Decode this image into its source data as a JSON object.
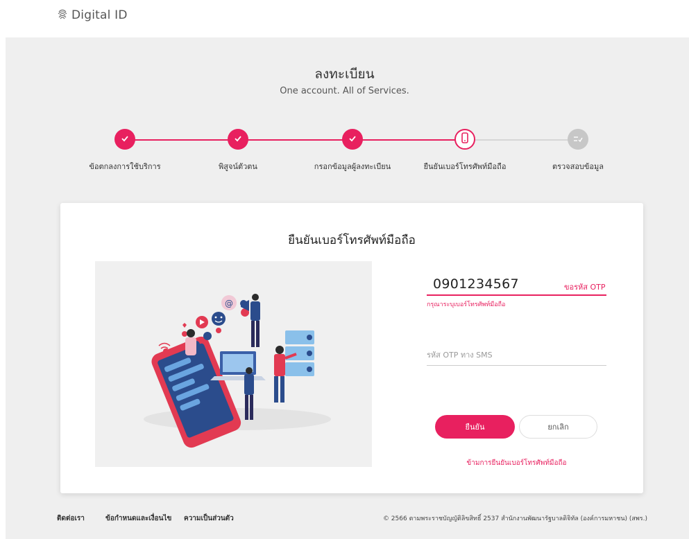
{
  "header": {
    "brand": "Digital ID"
  },
  "page": {
    "title": "ลงทะเบียน",
    "subtitle": "One account. All of Services."
  },
  "stepper": {
    "steps": [
      {
        "label": "ข้อตกลงการใช้บริการ",
        "state": "done"
      },
      {
        "label": "พิสูจน์ตัวตน",
        "state": "done"
      },
      {
        "label": "กรอกข้อมูลผู้ลงทะเบียน",
        "state": "done"
      },
      {
        "label": "ยืนยันเบอร์โทรศัพท์มือถือ",
        "state": "current"
      },
      {
        "label": "ตรวจสอบข้อมูล",
        "state": "todo"
      }
    ]
  },
  "card": {
    "title": "ยืนยันเบอร์โทรศัพท์มือถือ",
    "phone_value": "0901234567",
    "request_otp_label": "ขอรหัส OTP",
    "phone_error": "กรุณาระบุเบอร์โทรศัพท์มือถือ",
    "otp_placeholder": "รหัส OTP ทาง SMS",
    "confirm_label": "ยืนยัน",
    "cancel_label": "ยกเลิก",
    "skip_label": "ข้ามการยืนยันเบอร์โทรศัพท์มือถือ"
  },
  "footer": {
    "contact": "ติดต่อเรา",
    "terms": "ข้อกำหนดและเงื่อนไข",
    "privacy": "ความเป็นส่วนตัว",
    "copyright": "© 2566 ตามพระราชบัญญัติลิขสิทธิ์ 2537 สำนักงานพัฒนารัฐบาลดิจิทัล (องค์การมหาชน) (สพร.)"
  },
  "colors": {
    "accent": "#e8205f",
    "inactive": "#c7c7c7",
    "background": "#efefef"
  },
  "icons": {
    "brand": "fingerprint-icon",
    "done": "check-icon",
    "current": "mobile-phone-icon",
    "todo": "list-check-icon"
  }
}
